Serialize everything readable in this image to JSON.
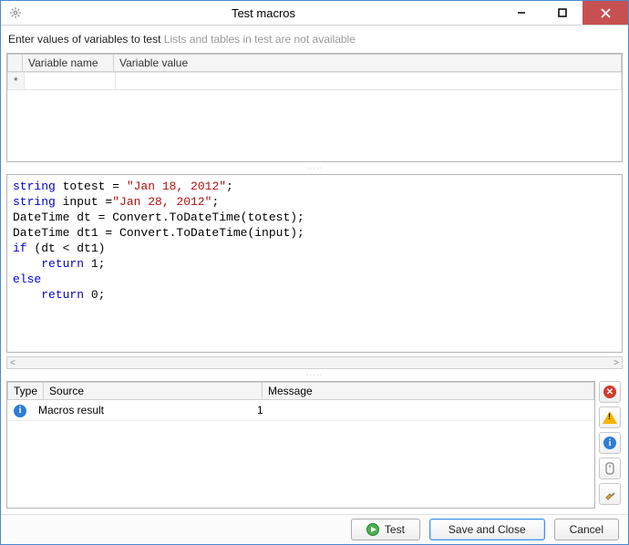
{
  "window": {
    "title": "Test macros"
  },
  "prompt": {
    "lead": "Enter values of variables to test",
    "hint": "Lists and tables in test are not available"
  },
  "vars_grid": {
    "col_rowhdr": "",
    "col_name": "Variable name",
    "col_value": "Variable value",
    "new_row_marker": "*"
  },
  "code": {
    "l1a": "string",
    "l1b": " totest = ",
    "l1c": "\"Jan 18, 2012\"",
    "l1d": ";",
    "l2a": "string",
    "l2b": " input =",
    "l2c": "\"Jan 28, 2012\"",
    "l2d": ";",
    "l3": "DateTime dt = Convert.ToDateTime(totest);",
    "l4": "DateTime dt1 = Convert.ToDateTime(input);",
    "l5a": "if",
    "l5b": " (dt < dt1)",
    "l6a": "    ",
    "l6b": "return",
    "l6c": " 1;",
    "l7": "else",
    "l8a": "    ",
    "l8b": "return",
    "l8c": " 0;"
  },
  "messages": {
    "col_type": "Type",
    "col_source": "Source",
    "col_message": "Message",
    "rows": [
      {
        "source": "Macros result",
        "message": "1"
      }
    ]
  },
  "side": {
    "clear": "clear",
    "warnings": "warnings",
    "info": "info",
    "scroll": "scroll",
    "highlight": "highlight"
  },
  "footer": {
    "test": "Test",
    "save": "Save and Close",
    "cancel": "Cancel"
  }
}
